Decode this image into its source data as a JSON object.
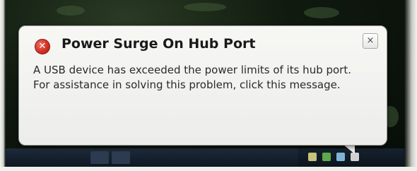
{
  "notification": {
    "title": "Power Surge On Hub Port",
    "icon": "error-icon",
    "close_glyph": "×",
    "line1": "A USB device has exceeded the power limits of its hub port.",
    "line2": "For assistance in solving this problem, click this message."
  },
  "colors": {
    "balloon_bg": "#f2f2ef",
    "error_red": "#d23226",
    "taskbar": "#162230"
  }
}
